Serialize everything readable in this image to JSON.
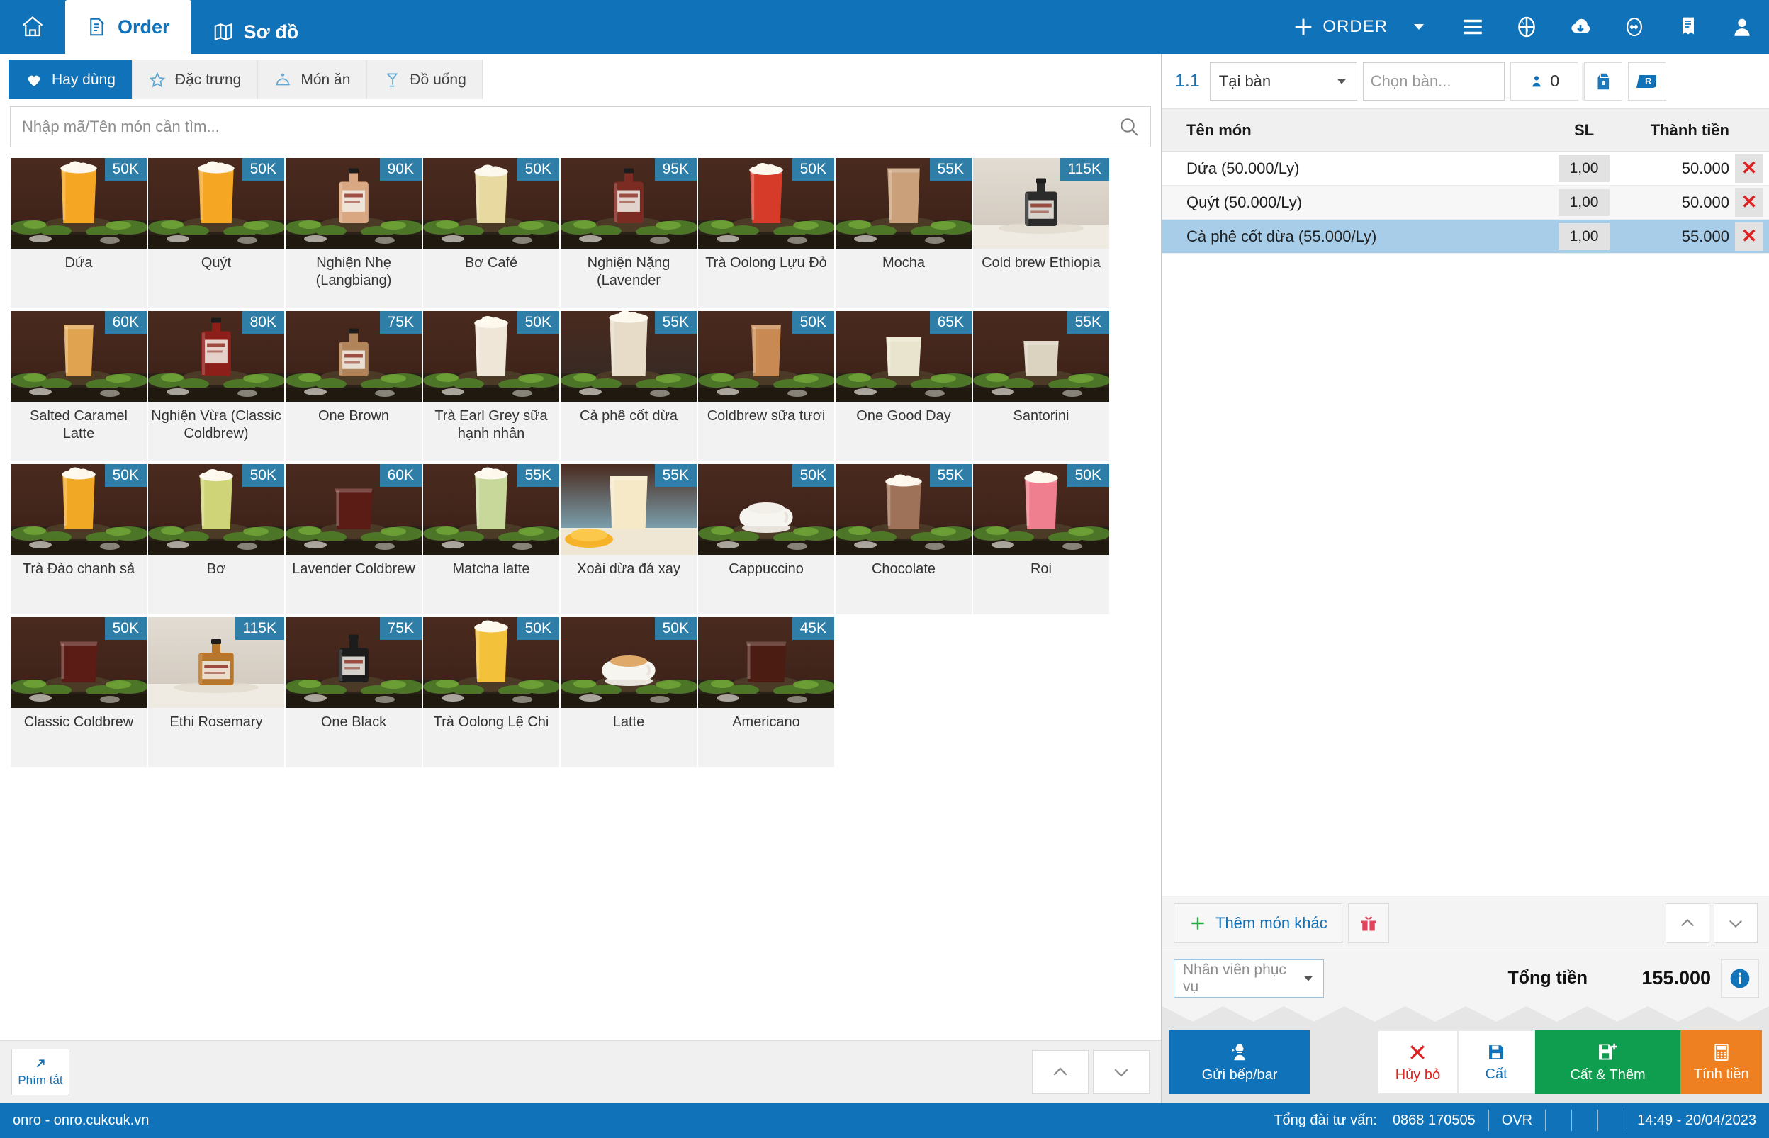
{
  "topbar": {
    "home_icon": "home-icon",
    "tabs": [
      {
        "label": "Order",
        "icon": "order-doc-icon",
        "active": true
      },
      {
        "label": "Sơ đồ",
        "icon": "map-icon",
        "active": false
      }
    ],
    "new_order_label": "ORDER",
    "icons": [
      "plus-icon",
      "chevron-down-icon",
      "hamburger-menu-icon",
      "globe-icon",
      "cloud-download-icon",
      "sync-icon",
      "receipt-icon",
      "user-icon"
    ]
  },
  "categories": [
    {
      "label": "Hay dùng",
      "icon": "heart-icon",
      "active": true
    },
    {
      "label": "Đặc trưng",
      "icon": "star-icon",
      "active": false
    },
    {
      "label": "Món ăn",
      "icon": "dish-icon",
      "active": false
    },
    {
      "label": "Đồ uống",
      "icon": "glass-icon",
      "active": false
    }
  ],
  "search": {
    "placeholder": "Nhập mã/Tên món cần tìm...",
    "value": "",
    "icon": "search-icon"
  },
  "products": [
    {
      "name": "Dứa",
      "price": "50K",
      "img": "juice-orange"
    },
    {
      "name": "Quýt",
      "price": "50K",
      "img": "juice-orange"
    },
    {
      "name": "Nghiện Nhẹ (Langbiang)",
      "price": "90K",
      "img": "bottle-tan"
    },
    {
      "name": "Bơ Café",
      "price": "50K",
      "img": "glass-cream"
    },
    {
      "name": "Nghiện Nặng (Lavender",
      "price": "95K",
      "img": "bottle-dark"
    },
    {
      "name": "Trà Oolong Lựu Đỏ",
      "price": "50K",
      "img": "glass-red"
    },
    {
      "name": "Mocha",
      "price": "55K",
      "img": "glass-mocha"
    },
    {
      "name": "Cold brew Ethiopia",
      "price": "115K",
      "img": "bottle-yellow-light"
    },
    {
      "name": "Salted Caramel Latte",
      "price": "60K",
      "img": "glass-caramel"
    },
    {
      "name": "Nghiện Vừa (Classic Coldbrew)",
      "price": "80K",
      "img": "bottle-red"
    },
    {
      "name": "One Brown",
      "price": "75K",
      "img": "bottle-brown"
    },
    {
      "name": "Trà Earl Grey sữa hạnh nhân",
      "price": "50K",
      "img": "glass-milk"
    },
    {
      "name": "Cà phê cốt dừa",
      "price": "55K",
      "img": "glass-frappe"
    },
    {
      "name": "Coldbrew sữa tươi",
      "price": "50K",
      "img": "glass-coldbrew"
    },
    {
      "name": "One Good Day",
      "price": "65K",
      "img": "jar-yellow"
    },
    {
      "name": "Santorini",
      "price": "55K",
      "img": "glass-short"
    },
    {
      "name": "Trà Đào chanh sả",
      "price": "50K",
      "img": "glass-peach"
    },
    {
      "name": "Bơ",
      "price": "50K",
      "img": "glass-avocado"
    },
    {
      "name": "Lavender Coldbrew",
      "price": "60K",
      "img": "glass-dark-ice"
    },
    {
      "name": "Matcha latte",
      "price": "55K",
      "img": "glass-matcha"
    },
    {
      "name": "Xoài dừa đá xay",
      "price": "55K",
      "img": "mango-blue"
    },
    {
      "name": "Cappuccino",
      "price": "50K",
      "img": "cup-cappuccino"
    },
    {
      "name": "Chocolate",
      "price": "55K",
      "img": "glass-choco"
    },
    {
      "name": "Roi",
      "price": "50K",
      "img": "glass-pink"
    },
    {
      "name": "Classic Coldbrew",
      "price": "50K",
      "img": "glass-dark-ice"
    },
    {
      "name": "Ethi Rosemary",
      "price": "115K",
      "img": "bottle-amber-light"
    },
    {
      "name": "One Black",
      "price": "75K",
      "img": "bottle-black"
    },
    {
      "name": "Trà Oolong Lệ Chi",
      "price": "50K",
      "img": "glass-yellow"
    },
    {
      "name": "Latte",
      "price": "50K",
      "img": "cup-latte"
    },
    {
      "name": "Americano",
      "price": "45K",
      "img": "glass-americano"
    }
  ],
  "left_footer": {
    "shortcut_label": "Phím tắt",
    "shortcut_icon": "arrow-up-right-icon",
    "scroll_up_icon": "chevron-up-icon",
    "scroll_down_icon": "chevron-down-icon"
  },
  "order_panel": {
    "order_number": "1.1",
    "order_type": "Tại bàn",
    "table_placeholder": "Chọn bàn...",
    "table_value": "",
    "search_icon": "search-icon",
    "guest_icon": "person-icon",
    "guest_count": "0",
    "takeaway_icon": "takeaway-bag-icon",
    "r_badge": "R",
    "columns": {
      "name": "Tên món",
      "qty": "SL",
      "amount": "Thành tiền"
    },
    "items": [
      {
        "name": "Dứa (50.000/Ly)",
        "qty": "1,00",
        "amount": "50.000",
        "selected": false
      },
      {
        "name": "Quýt (50.000/Ly)",
        "qty": "1,00",
        "amount": "50.000",
        "selected": false
      },
      {
        "name": "Cà phê cốt dừa (55.000/Ly)",
        "qty": "1,00",
        "amount": "55.000",
        "selected": true
      }
    ],
    "remove_label": "✕",
    "add_more_label": "Thêm món khác",
    "add_icon": "plus-icon",
    "gift_icon": "gift-icon",
    "scroll_up_icon": "chevron-up-icon",
    "scroll_down_icon": "chevron-down-icon",
    "staff_placeholder": "Nhân viên phục vụ",
    "total_label": "Tổng tiền",
    "total_value": "155.000",
    "info_icon": "info-icon",
    "actions": [
      {
        "label": "Gửi bếp/bar",
        "icon": "chef-icon",
        "color": "#1072b8"
      },
      {
        "label": "Hủy bỏ",
        "icon": "x-icon",
        "color": "#ffffff"
      },
      {
        "label": "Cất",
        "icon": "save-icon",
        "color": "#ffffff"
      },
      {
        "label": "Cất & Thêm",
        "icon": "save-plus-icon",
        "color": "#0f9d4f"
      },
      {
        "label": "Tính tiền",
        "icon": "calculator-icon",
        "color": "#ef8022"
      }
    ]
  },
  "statusbar": {
    "site": "onro - onro.cukcuk.vn",
    "hotline_label": "Tổng đài tư vấn:",
    "hotline_number": "0868 170505",
    "mode": "OVR",
    "datetime": "14:49 - 20/04/2023"
  },
  "colors": {
    "brand_blue": "#1072b8",
    "badge_blue": "#2e7ea8",
    "green": "#0f9d4f",
    "orange": "#ef8022",
    "red": "#e02020",
    "selected_row": "#a8cde8"
  }
}
